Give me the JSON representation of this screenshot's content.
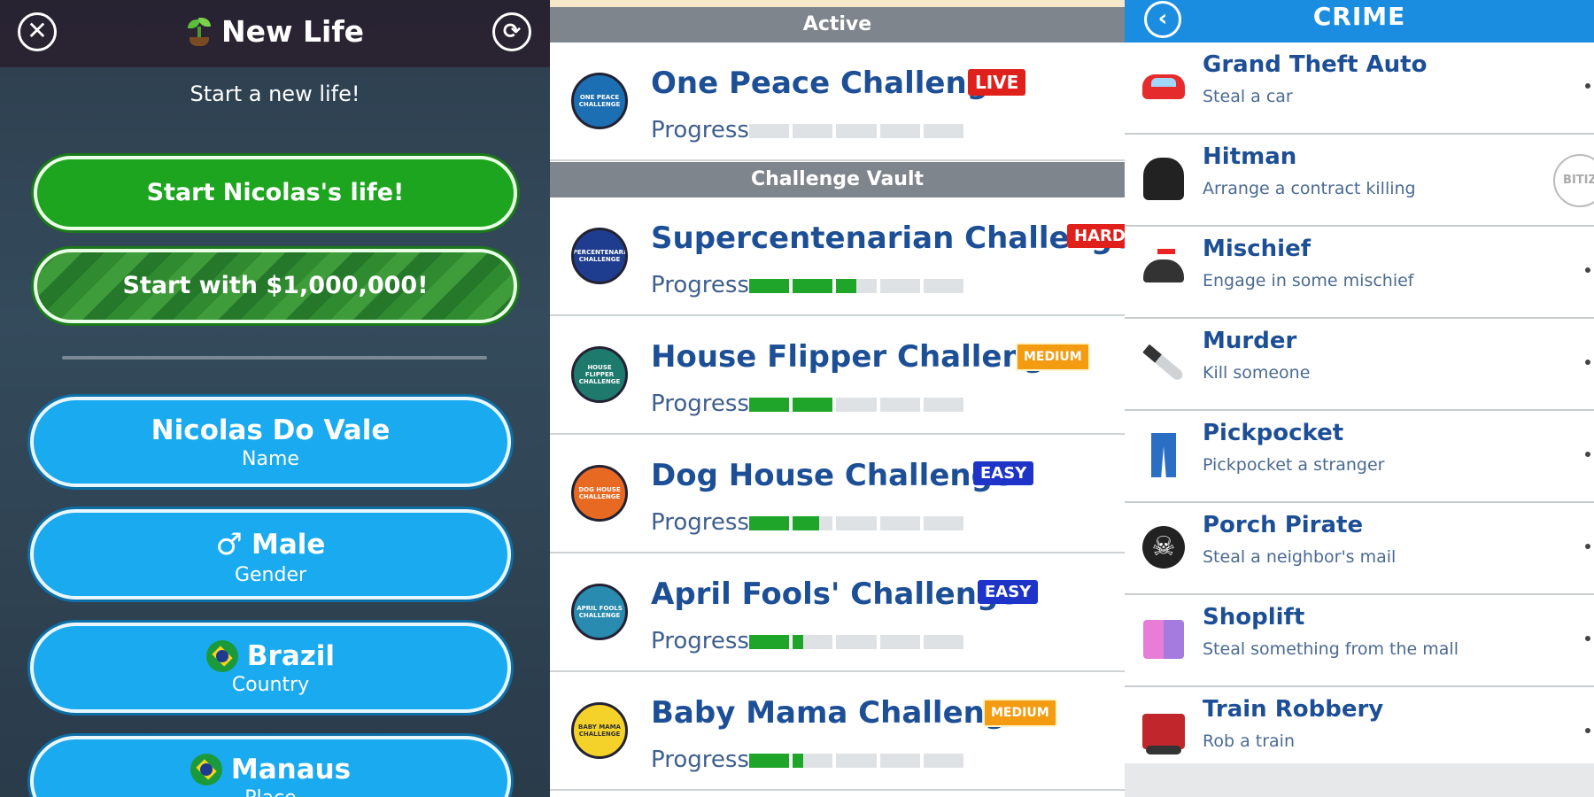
{
  "new_life": {
    "title": "New Life",
    "subtitle": "Start a new life!",
    "close_icon": "close-icon",
    "refresh_icon": "refresh-icon",
    "start_life_label": "Start Nicolas's life!",
    "start_million_label": "Start with $1,000,000!",
    "fields": [
      {
        "value": "Nicolas Do Vale",
        "label": "Name"
      },
      {
        "value": "Male",
        "label": "Gender",
        "icon": "male-icon"
      },
      {
        "value": "Brazil",
        "label": "Country",
        "icon": "brazil-flag-icon"
      },
      {
        "value": "Manaus",
        "label": "Place",
        "icon": "brazil-flag-icon"
      }
    ]
  },
  "challenges": {
    "active_header": "Active",
    "vault_header": "Challenge Vault",
    "progress_label": "Progress",
    "active": [
      {
        "title": "One Peace Challenge",
        "tag": "LIVE",
        "badge_text": "ONE PEACE CHALLENGE",
        "badge_color": "#1c6fb3",
        "progress": 0.0
      }
    ],
    "vault": [
      {
        "title": "Supercentenarian Challenge",
        "tag": "HARD",
        "badge_text": "SUPERCENTENARIAN CHALLENGE",
        "badge_color": "#1f3d8f",
        "progress": 0.5
      },
      {
        "title": "House Flipper Challenge",
        "tag": "MEDIUM",
        "badge_text": "HOUSE FLIPPER CHALLENGE",
        "badge_color": "#1f7a6e",
        "progress": 0.4
      },
      {
        "title": "Dog House Challenge",
        "tag": "EASY",
        "badge_text": "DOG HOUSE CHALLENGE",
        "badge_color": "#e86a22",
        "progress": 0.33
      },
      {
        "title": "April Fools' Challenge",
        "tag": "EASY",
        "badge_text": "APRIL FOOLS CHALLENGE",
        "badge_color": "#2a8bb0",
        "progress": 0.25
      },
      {
        "title": "Baby Mama Challenge",
        "tag": "MEDIUM",
        "badge_text": "BABY MAMA CHALLENGE",
        "badge_color": "#f4d22a",
        "progress": 0.25
      }
    ]
  },
  "crime": {
    "title": "CRIME",
    "back_icon": "back-icon",
    "items": [
      {
        "title": "Grand Theft Auto",
        "desc": "Steal a car",
        "icon": "car-icon"
      },
      {
        "title": "Hitman",
        "desc": "Arrange a contract killing",
        "icon": "hitman-icon"
      },
      {
        "title": "Mischief",
        "desc": "Engage in some mischief",
        "icon": "propeller-cap-icon"
      },
      {
        "title": "Murder",
        "desc": "Kill someone",
        "icon": "knife-icon"
      },
      {
        "title": "Pickpocket",
        "desc": "Pickpocket a stranger",
        "icon": "jeans-icon"
      },
      {
        "title": "Porch Pirate",
        "desc": "Steal a neighbor's mail",
        "icon": "skull-crossbones-icon"
      },
      {
        "title": "Shoplift",
        "desc": "Steal something from the mall",
        "icon": "shopping-bags-icon"
      },
      {
        "title": "Train Robbery",
        "desc": "Rob a train",
        "icon": "train-icon"
      }
    ]
  },
  "colors": {
    "green_button": "#1ea520",
    "blue_button": "#1aaaf0",
    "title_blue": "#1d4f96",
    "progress_green": "#1fa52a",
    "tag_live": "#e0201b",
    "tag_easy": "#1e33c8",
    "tag_medium": "#f39c12",
    "crime_header": "#1b8de0"
  }
}
